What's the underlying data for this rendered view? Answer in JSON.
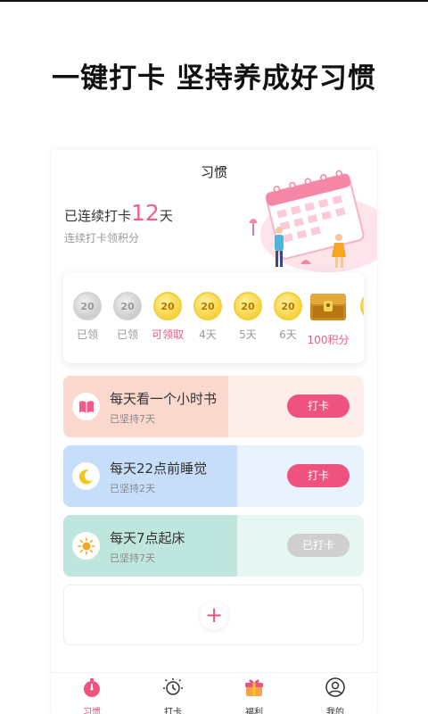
{
  "headline": "一键打卡 坚持养成好习惯",
  "header": {
    "title": "习惯"
  },
  "streak": {
    "prefix": "已连续打卡",
    "days": "12",
    "suffix": "天",
    "subtitle": "连续打卡领积分"
  },
  "rewards": [
    {
      "value": "20",
      "label": "已领",
      "state": "claimed"
    },
    {
      "value": "20",
      "label": "已领",
      "state": "claimed"
    },
    {
      "value": "20",
      "label": "可领取",
      "state": "available"
    },
    {
      "value": "20",
      "label": "4天",
      "state": "locked"
    },
    {
      "value": "20",
      "label": "5天",
      "state": "locked"
    },
    {
      "value": "20",
      "label": "6天",
      "state": "locked"
    },
    {
      "value": "",
      "label": "100积分",
      "state": "chest"
    }
  ],
  "habits": [
    {
      "title": "每天看一个小时书",
      "subtitle": "已坚持7天",
      "button": "打卡",
      "icon": "book-icon",
      "progress": 0.55,
      "bg": "#fdeee9",
      "fill": "#fbd8cd",
      "button_state": "active"
    },
    {
      "title": "每天22点前睡觉",
      "subtitle": "已坚持2天",
      "button": "打卡",
      "icon": "moon-icon",
      "progress": 0.58,
      "bg": "#e8f2fd",
      "fill": "#c6def9",
      "button_state": "active"
    },
    {
      "title": "每天7点起床",
      "subtitle": "已坚持7天",
      "button": "已打卡",
      "icon": "sun-icon",
      "progress": 0.58,
      "bg": "#e6f6f3",
      "fill": "#bfe6de",
      "button_state": "done"
    }
  ],
  "add": {
    "symbol": "+"
  },
  "tabs": [
    {
      "label": "习惯",
      "icon": "stopwatch-icon",
      "active": true
    },
    {
      "label": "打卡",
      "icon": "alarm-icon",
      "active": false
    },
    {
      "label": "福利",
      "icon": "gift-icon",
      "active": false
    },
    {
      "label": "我的",
      "icon": "user-icon",
      "active": false
    }
  ],
  "colors": {
    "accent": "#f0527f",
    "gold": "#f5c518"
  }
}
